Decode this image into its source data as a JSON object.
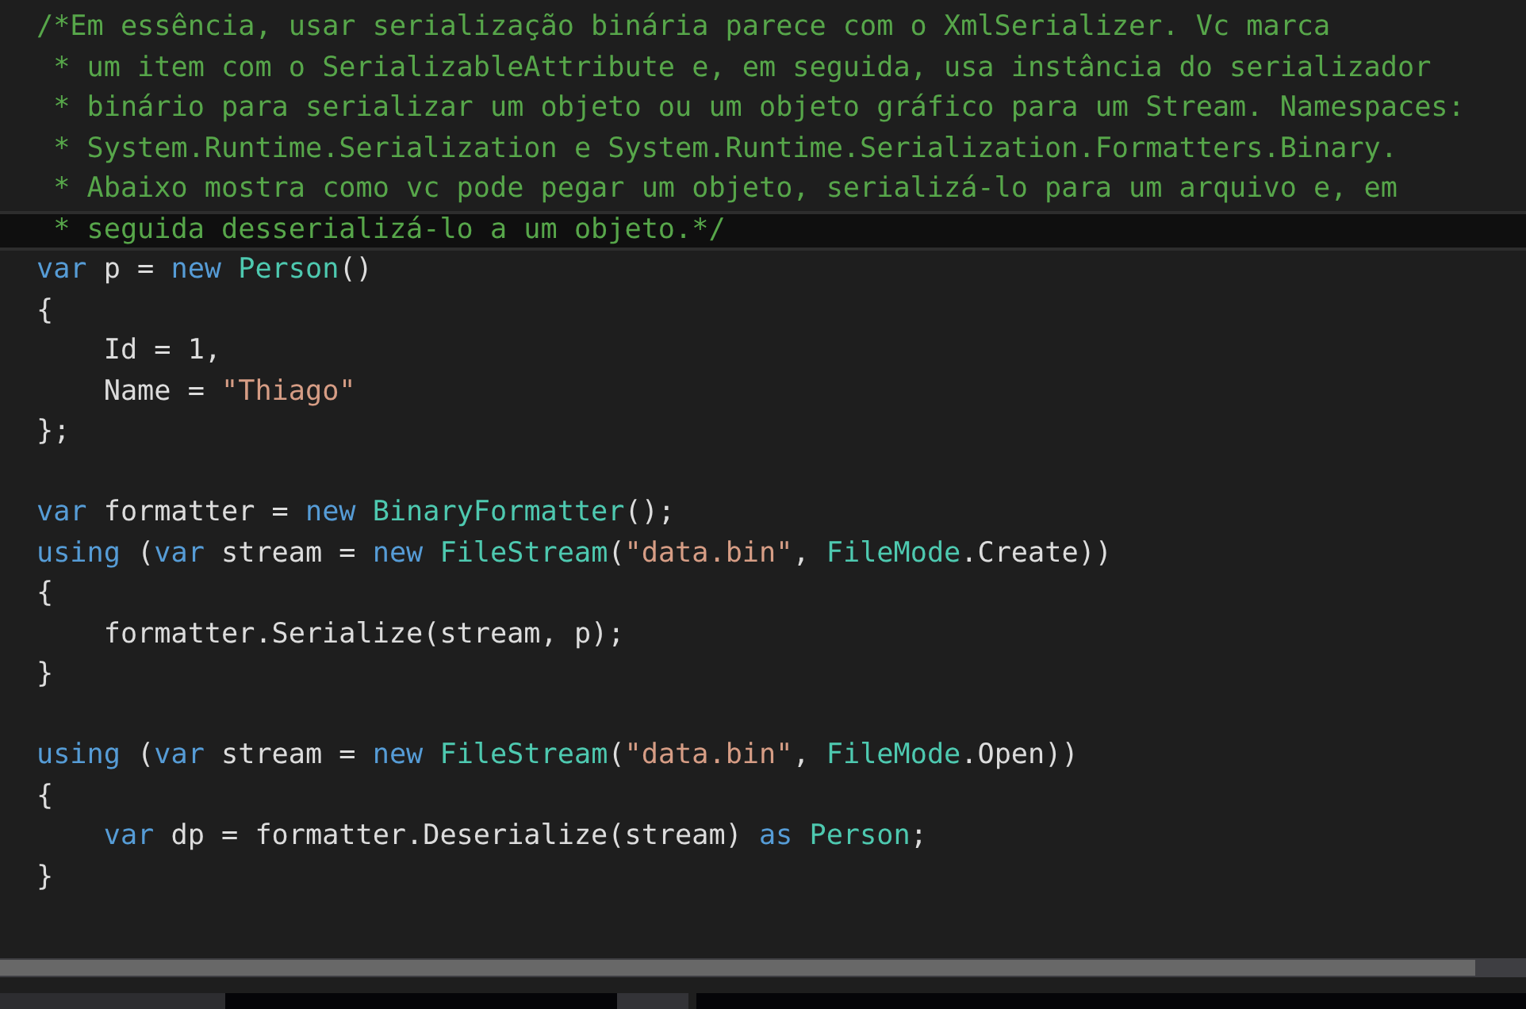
{
  "lines": [
    {
      "current": false,
      "tokens": [
        {
          "kind": "comment",
          "text": "/*Em essência, usar serialização binária parece com o XmlSerializer. Vc marca"
        }
      ]
    },
    {
      "current": false,
      "tokens": [
        {
          "kind": "comment",
          "text": " * um item com o SerializableAttribute e, em seguida, usa instância do serializador"
        }
      ]
    },
    {
      "current": false,
      "tokens": [
        {
          "kind": "comment",
          "text": " * binário para serializar um objeto ou um objeto gráfico para um Stream. Namespaces:"
        }
      ]
    },
    {
      "current": false,
      "tokens": [
        {
          "kind": "comment",
          "text": " * System.Runtime.Serialization e System.Runtime.Serialization.Formatters.Binary."
        }
      ]
    },
    {
      "current": false,
      "tokens": [
        {
          "kind": "comment",
          "text": " * Abaixo mostra como vc pode pegar um objeto, serializá-lo para um arquivo e, em"
        }
      ]
    },
    {
      "current": true,
      "tokens": [
        {
          "kind": "comment",
          "text": " * seguida desserializá-lo a um objeto.*/"
        }
      ]
    },
    {
      "current": false,
      "tokens": [
        {
          "kind": "keyword",
          "text": "var"
        },
        {
          "kind": "plain",
          "text": " p = "
        },
        {
          "kind": "keyword",
          "text": "new "
        },
        {
          "kind": "type",
          "text": "Person"
        },
        {
          "kind": "plain",
          "text": "()"
        }
      ]
    },
    {
      "current": false,
      "tokens": [
        {
          "kind": "plain",
          "text": "{"
        }
      ]
    },
    {
      "current": false,
      "indent": true,
      "tokens": [
        {
          "kind": "plain",
          "text": "Id = 1,"
        }
      ]
    },
    {
      "current": false,
      "indent": true,
      "tokens": [
        {
          "kind": "plain",
          "text": "Name = "
        },
        {
          "kind": "string",
          "text": "\"Thiago\""
        }
      ]
    },
    {
      "current": false,
      "tokens": [
        {
          "kind": "plain",
          "text": "};"
        }
      ]
    },
    {
      "current": false
    },
    {
      "current": false,
      "tokens": [
        {
          "kind": "keyword",
          "text": "var"
        },
        {
          "kind": "plain",
          "text": " formatter = "
        },
        {
          "kind": "keyword",
          "text": "new "
        },
        {
          "kind": "type",
          "text": "BinaryFormatter"
        },
        {
          "kind": "plain",
          "text": "();"
        }
      ]
    },
    {
      "current": false,
      "tokens": [
        {
          "kind": "keyword",
          "text": "using"
        },
        {
          "kind": "plain",
          "text": " ("
        },
        {
          "kind": "keyword",
          "text": "var"
        },
        {
          "kind": "plain",
          "text": " stream = "
        },
        {
          "kind": "keyword",
          "text": "new "
        },
        {
          "kind": "type",
          "text": "FileStream"
        },
        {
          "kind": "plain",
          "text": "("
        },
        {
          "kind": "string",
          "text": "\"data.bin\""
        },
        {
          "kind": "plain",
          "text": ", "
        },
        {
          "kind": "type",
          "text": "FileMode"
        },
        {
          "kind": "plain",
          "text": ".Create))"
        }
      ]
    },
    {
      "current": false,
      "tokens": [
        {
          "kind": "plain",
          "text": "{"
        }
      ]
    },
    {
      "current": false,
      "indent": true,
      "tokens": [
        {
          "kind": "plain",
          "text": "formatter.Serialize(stream, p);"
        }
      ]
    },
    {
      "current": false,
      "tokens": [
        {
          "kind": "plain",
          "text": "}"
        }
      ]
    },
    {
      "current": false
    },
    {
      "current": false,
      "tokens": [
        {
          "kind": "keyword",
          "text": "using"
        },
        {
          "kind": "plain",
          "text": " ("
        },
        {
          "kind": "keyword",
          "text": "var"
        },
        {
          "kind": "plain",
          "text": " stream = "
        },
        {
          "kind": "keyword",
          "text": "new "
        },
        {
          "kind": "type",
          "text": "FileStream"
        },
        {
          "kind": "plain",
          "text": "("
        },
        {
          "kind": "string",
          "text": "\"data.bin\""
        },
        {
          "kind": "plain",
          "text": ", "
        },
        {
          "kind": "type",
          "text": "FileMode"
        },
        {
          "kind": "plain",
          "text": ".Open))"
        }
      ]
    },
    {
      "current": false,
      "tokens": [
        {
          "kind": "plain",
          "text": "{"
        }
      ]
    },
    {
      "current": false,
      "indent": true,
      "tokens": [
        {
          "kind": "keyword",
          "text": "var"
        },
        {
          "kind": "plain",
          "text": " dp = formatter.Deserialize(stream) "
        },
        {
          "kind": "keyword",
          "text": "as "
        },
        {
          "kind": "type",
          "text": "Person"
        },
        {
          "kind": "plain",
          "text": ";"
        }
      ]
    },
    {
      "current": false,
      "tokens": [
        {
          "kind": "plain",
          "text": "}"
        }
      ]
    }
  ]
}
